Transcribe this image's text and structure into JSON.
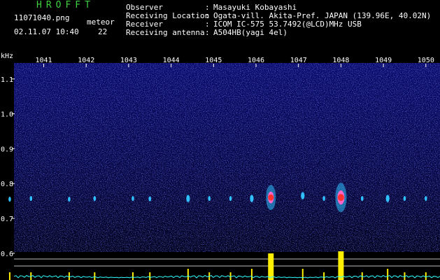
{
  "header": {
    "app_title": "HROFFT",
    "file_name": "11071040.png",
    "meteor_label": "meteor",
    "datetime": "02.11.07 10:40",
    "meteor_count": "22",
    "info": [
      {
        "label": "Observer",
        "value": "Masayuki Kobayashi"
      },
      {
        "label": "Receiving Location",
        "value": "Ogata-vill. Akita-Pref. JAPAN (139.96E, 40.02N)"
      },
      {
        "label": "Receiver",
        "value": "ICOM IC-575 53.7492(@LCD)MHz USB"
      },
      {
        "label": "Receiving antenna",
        "value": "A504HB(yagi 4el)"
      }
    ],
    "separator": ":"
  },
  "spectrogram": {
    "unit_label": "kHz",
    "time_ticks": [
      "1041",
      "1042",
      "1043",
      "1044",
      "1045",
      "1046",
      "1047",
      "1048",
      "1049",
      "1050"
    ],
    "freq_ticks": [
      "1.1",
      "1.0",
      "0.9",
      "0.8",
      "0.7",
      "0.6"
    ],
    "colors": {
      "background": "#00004a",
      "noise": "#2a2aa8",
      "echo_hot": "#ff3030",
      "echo_mid": "#ff66cc",
      "echo_cool": "#30c0ff",
      "level_bar": "#ffee00",
      "baseline": "#30ffff",
      "guide_line": "#c8c8c8"
    },
    "meteor_echoes": [
      {
        "minute": 1040.2,
        "freq": 0.755,
        "strength": 1
      },
      {
        "minute": 1040.7,
        "freq": 0.757,
        "strength": 1
      },
      {
        "minute": 1041.6,
        "freq": 0.755,
        "strength": 1
      },
      {
        "minute": 1042.2,
        "freq": 0.757,
        "strength": 1
      },
      {
        "minute": 1043.1,
        "freq": 0.757,
        "strength": 1
      },
      {
        "minute": 1043.5,
        "freq": 0.756,
        "strength": 1
      },
      {
        "minute": 1044.4,
        "freq": 0.757,
        "strength": 2
      },
      {
        "minute": 1044.9,
        "freq": 0.757,
        "strength": 1
      },
      {
        "minute": 1045.4,
        "freq": 0.757,
        "strength": 1
      },
      {
        "minute": 1045.9,
        "freq": 0.757,
        "strength": 2
      },
      {
        "minute": 1046.35,
        "freq": 0.76,
        "strength": 4
      },
      {
        "minute": 1047.1,
        "freq": 0.765,
        "strength": 2
      },
      {
        "minute": 1047.6,
        "freq": 0.757,
        "strength": 1
      },
      {
        "minute": 1048.0,
        "freq": 0.76,
        "strength": 5
      },
      {
        "minute": 1048.5,
        "freq": 0.757,
        "strength": 1
      },
      {
        "minute": 1049.1,
        "freq": 0.757,
        "strength": 2
      },
      {
        "minute": 1049.5,
        "freq": 0.757,
        "strength": 1
      },
      {
        "minute": 1050.0,
        "freq": 0.757,
        "strength": 1
      }
    ]
  }
}
